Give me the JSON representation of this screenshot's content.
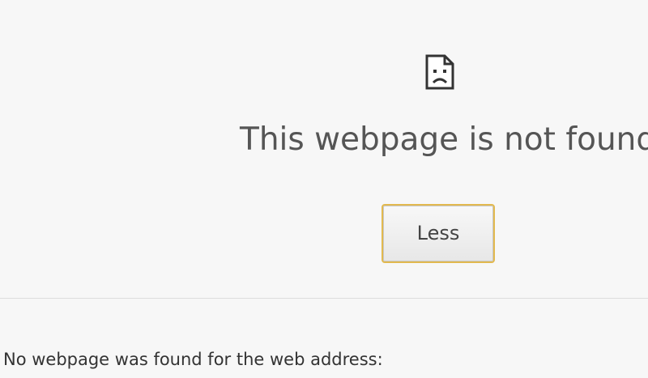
{
  "error": {
    "icon": "sad-file-icon",
    "title": "This webpage is not found",
    "button_label": "Less",
    "details_text": "No webpage was found for the web address:"
  },
  "colors": {
    "background": "#f7f7f7",
    "title_text": "#555555",
    "button_focus_border": "#e2b94f",
    "divider": "#dddddd"
  }
}
